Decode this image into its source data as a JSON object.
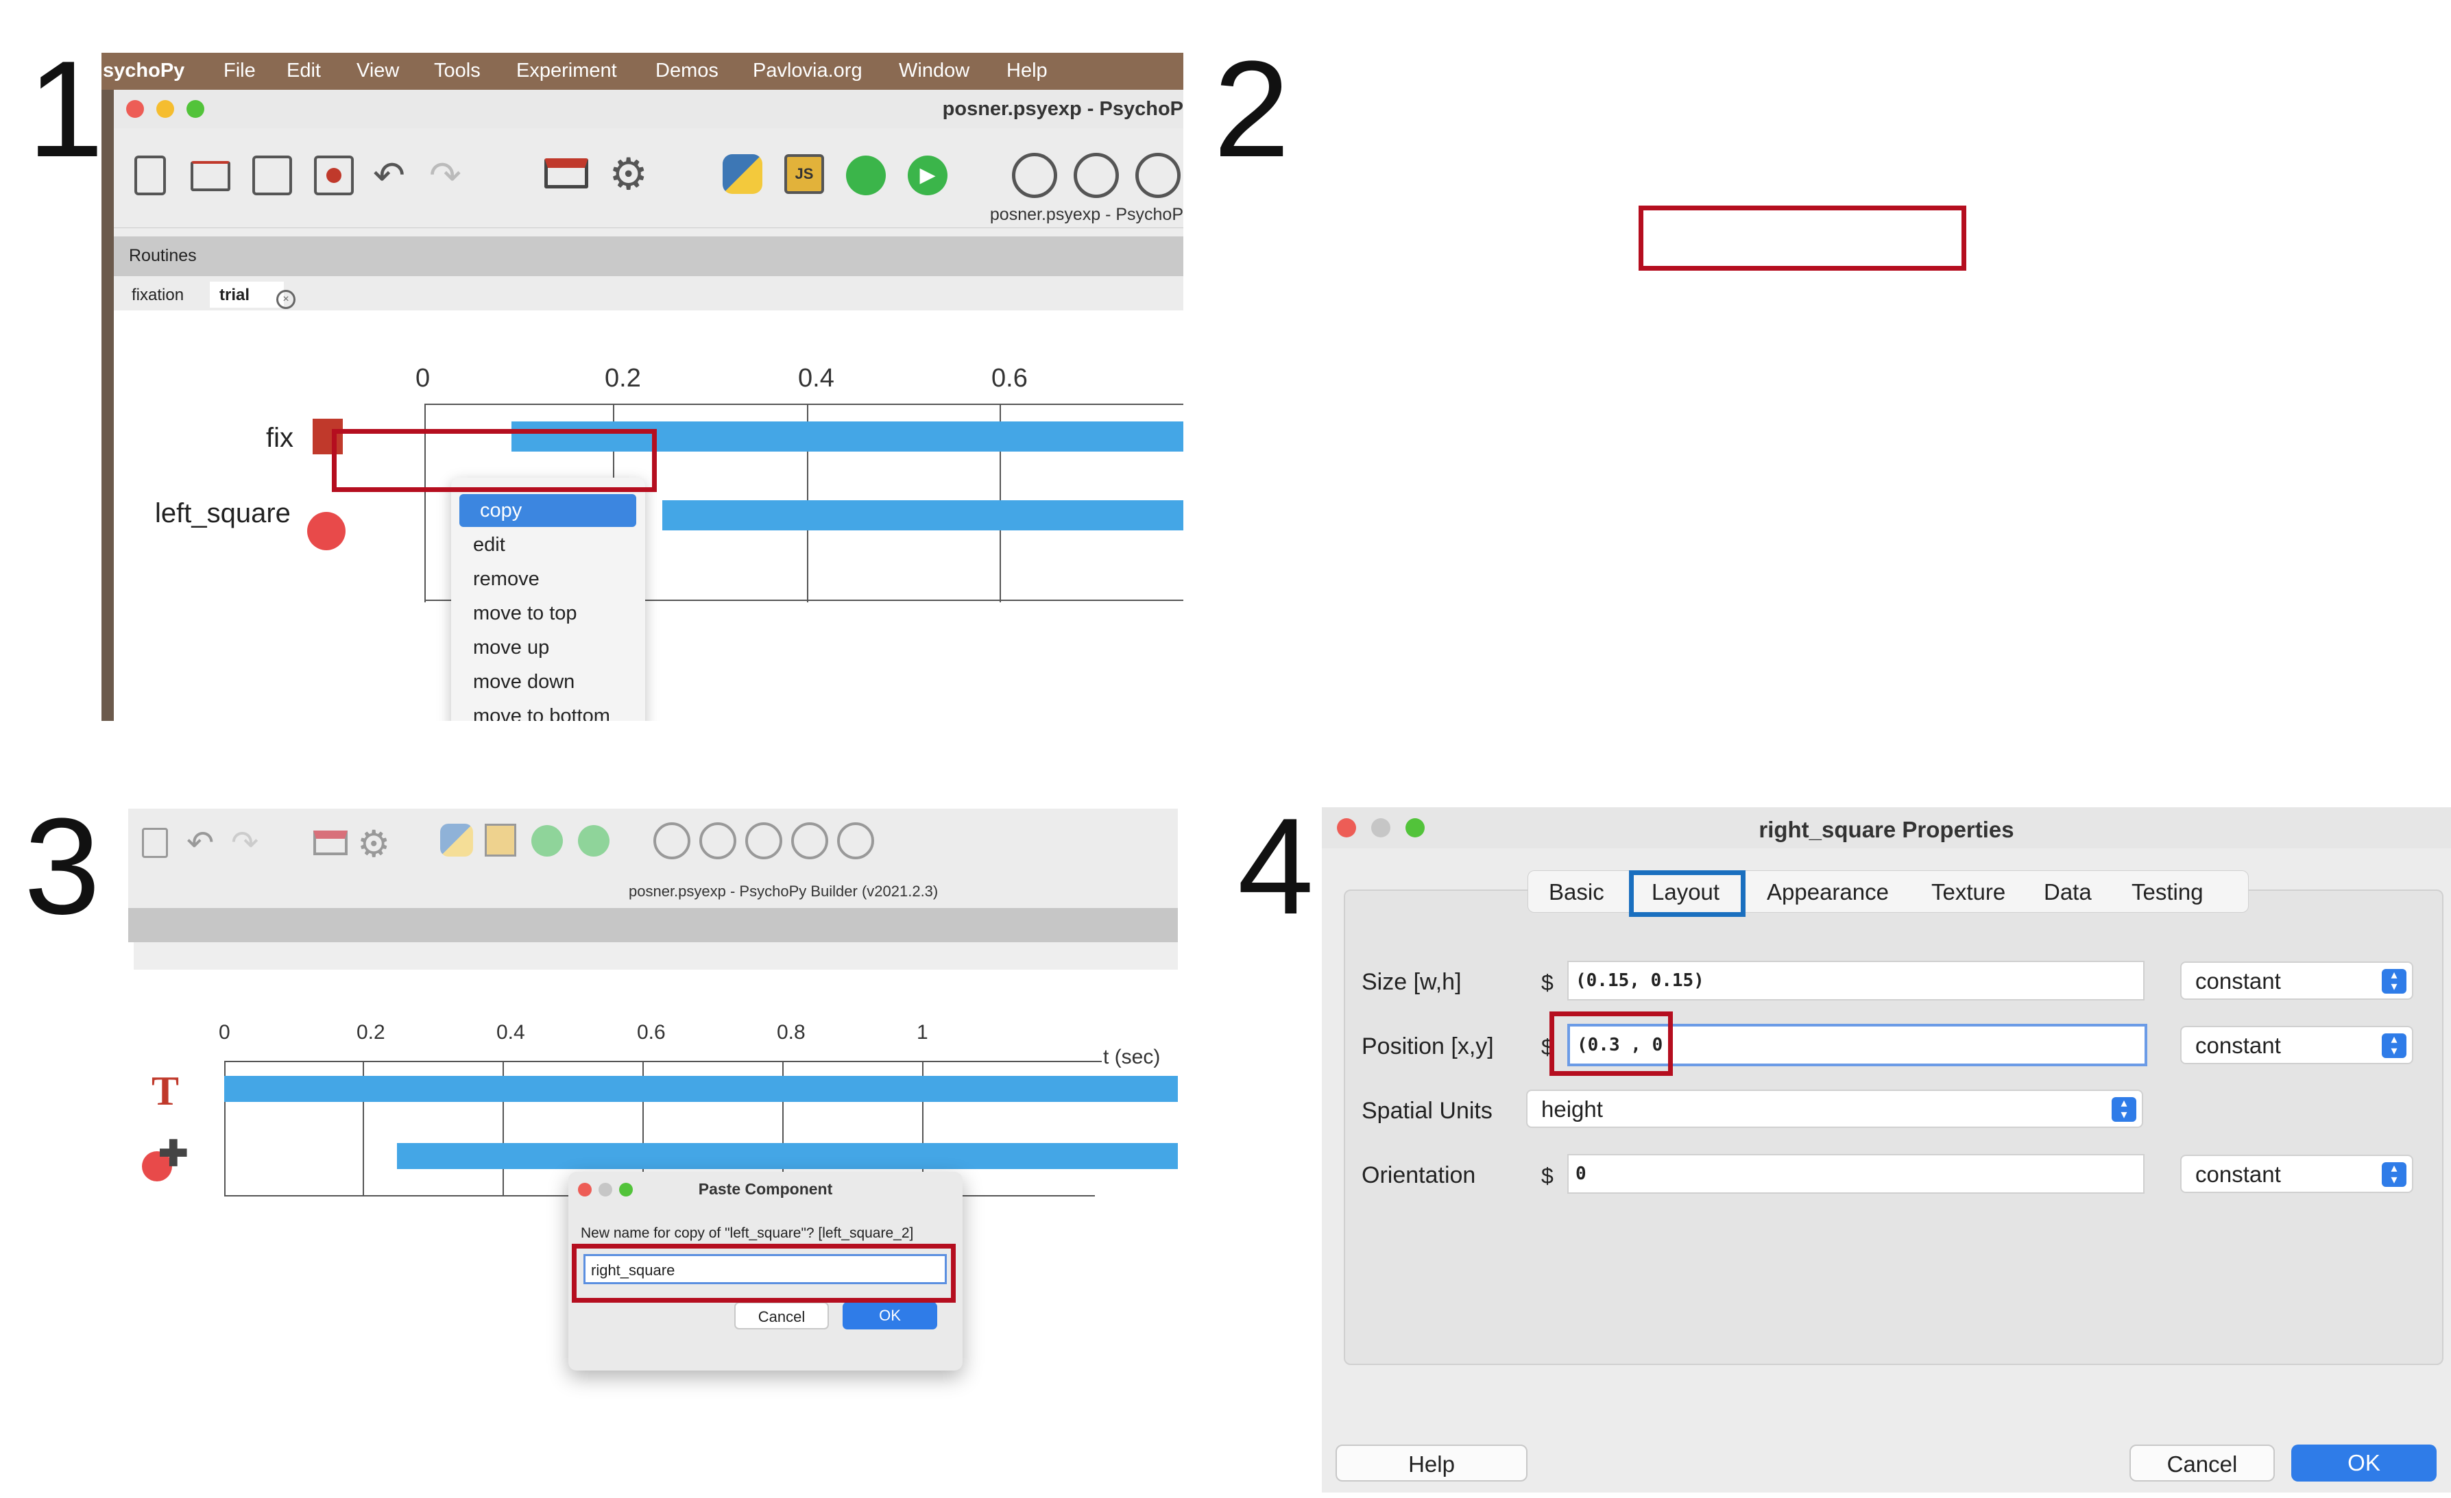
{
  "step_numbers": [
    "1",
    "2",
    "3",
    "4"
  ],
  "panel1": {
    "menubar": [
      "sychoPy",
      "File",
      "Edit",
      "View",
      "Tools",
      "Experiment",
      "Demos",
      "Pavlovia.org",
      "Window",
      "Help"
    ],
    "window_title": "posner.psyexp - PsychoP",
    "subtitle": "posner.psyexp - PsychoP",
    "routines_label": "Routines",
    "tabs": [
      "fixation",
      "trial"
    ],
    "timeline_ticks": [
      "0",
      "0.2",
      "0.4",
      "0.6"
    ],
    "components": [
      "fix",
      "left_square"
    ],
    "context_menu": [
      "copy",
      "edit",
      "remove",
      "move to top",
      "move up",
      "move down",
      "move to bottom"
    ]
  },
  "panel3": {
    "subtitle": "posner.psyexp - PsychoPy Builder (v2021.2.3)",
    "timeline_ticks": [
      "0",
      "0.2",
      "0.4",
      "0.6",
      "0.8",
      "1"
    ],
    "time_axis_label": "t (sec)",
    "dialog": {
      "title": "Paste Component",
      "prompt": "New name for copy of \"left_square\"?  [left_square_2]",
      "value": "right_square",
      "cancel": "Cancel",
      "ok": "OK"
    }
  },
  "panel4": {
    "title": "right_square Properties",
    "tabs": [
      "Basic",
      "Layout",
      "Appearance",
      "Texture",
      "Data",
      "Testing"
    ],
    "active_tab": "Layout",
    "rows": [
      {
        "label": "Size [w,h]",
        "dollar": "$",
        "value": "(0.15, 0.15)",
        "update": "constant"
      },
      {
        "label": "Position [x,y]",
        "dollar": "$",
        "value": "(0.3 , 0",
        "update": "constant"
      },
      {
        "label": "Spatial Units",
        "value": "height"
      },
      {
        "label": "Orientation",
        "dollar": "$",
        "value": "0",
        "update": "constant"
      }
    ],
    "help": "Help",
    "cancel": "Cancel",
    "ok": "OK"
  },
  "colors": {
    "highlight_red": "#b50e1f",
    "highlight_blue": "#1a6fbf",
    "timeline_bar": "#44a6e6",
    "menu_selection": "#3c86e0"
  }
}
